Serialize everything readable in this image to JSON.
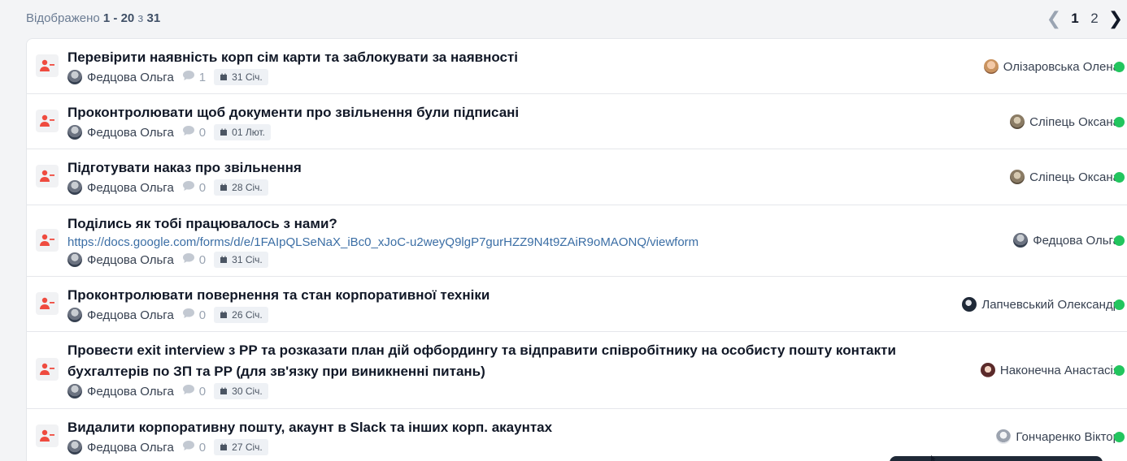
{
  "header": {
    "showing_prefix": "Відображено",
    "range": "1 - 20",
    "of_word": "з",
    "total": "31"
  },
  "pagination": {
    "prev_icon": "chevron-left-icon",
    "pages": [
      "1",
      "2"
    ],
    "active_page": "1",
    "next_icon": "chevron-right-icon"
  },
  "colors": {
    "status_active": "#22c55e",
    "task_icon": "#ef4b3f",
    "link": "#3b6ea5"
  },
  "tasks": [
    {
      "title": "Перевірити наявність корп сім карти та заблокувати за наявності",
      "author": "Федцова Ольга",
      "comments": "1",
      "date": "31 Січ.",
      "assignee": "Олізаровська Олена"
    },
    {
      "title": "Проконтролювати щоб документи про звільнення були підписані",
      "author": "Федцова Ольга",
      "comments": "0",
      "date": "01 Лют.",
      "assignee": "Сліпець Оксана"
    },
    {
      "title": "Підготувати наказ про звільнення",
      "author": "Федцова Ольга",
      "comments": "0",
      "date": "28 Січ.",
      "assignee": "Сліпець Оксана"
    },
    {
      "title": "Поділись як тобі працювалось з нами?",
      "link": "https://docs.google.com/forms/d/e/1FAIpQLSeNaX_iBc0_xJoC-u2weyQ9lgP7gurHZZ9N4t9ZAiR9oMAONQ/viewform",
      "author": "Федцова Ольга",
      "comments": "0",
      "date": "31 Січ.",
      "assignee": "Федцова Ольга"
    },
    {
      "title": "Проконтролювати повернення та стан корпоративної техніки",
      "author": "Федцова Ольга",
      "comments": "0",
      "date": "26 Січ.",
      "assignee": "Лапчевський Олександр"
    },
    {
      "title": "Провести exit interview з PP та розказати план дій офбордингу та відправити співробітнику на особисту пошту контакти бухгалтерів по ЗП та PP (для зв'язку при виникненні питань)",
      "author": "Федцова Ольга",
      "comments": "0",
      "date": "30 Січ.",
      "assignee": "Наконечна Анастасія"
    },
    {
      "title": "Видалити корпоративну пошту, акаунт в Slack та інших корп. акаунтах",
      "author": "Федцова Ольга",
      "comments": "0",
      "date": "27 Січ.",
      "assignee": "Гончаренко Віктор"
    }
  ]
}
